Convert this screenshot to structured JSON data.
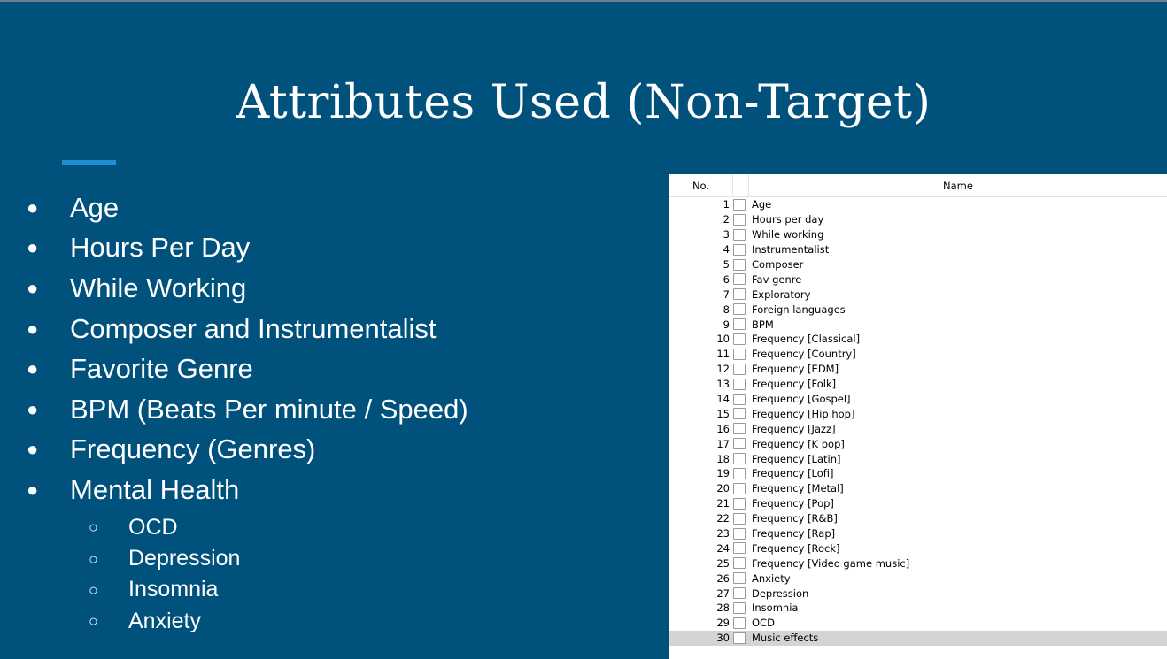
{
  "slide": {
    "title": "Attributes Used (Non-Target)",
    "bullets": [
      "Age",
      "Hours Per Day",
      "While Working",
      "Composer and Instrumentalist",
      "Favorite Genre",
      "BPM (Beats Per minute / Speed)",
      "Frequency (Genres)",
      "Mental Health"
    ],
    "sub_bullets": [
      "OCD",
      "Depression",
      "Insomnia",
      "Anxiety"
    ],
    "bullet_glyph": "●",
    "sub_bullet_glyph": "○",
    "colors": {
      "background": "#00527d",
      "accent_line": "#1e8fd6",
      "text": "#ffffff"
    }
  },
  "attribute_table": {
    "header_no": "No.",
    "header_name": "Name",
    "selected_index": 30,
    "rows": [
      {
        "no": "1",
        "name": "Age"
      },
      {
        "no": "2",
        "name": "Hours per day"
      },
      {
        "no": "3",
        "name": "While working"
      },
      {
        "no": "4",
        "name": "Instrumentalist"
      },
      {
        "no": "5",
        "name": "Composer"
      },
      {
        "no": "6",
        "name": "Fav genre"
      },
      {
        "no": "7",
        "name": "Exploratory"
      },
      {
        "no": "8",
        "name": "Foreign languages"
      },
      {
        "no": "9",
        "name": "BPM"
      },
      {
        "no": "10",
        "name": "Frequency [Classical]"
      },
      {
        "no": "11",
        "name": "Frequency [Country]"
      },
      {
        "no": "12",
        "name": "Frequency [EDM]"
      },
      {
        "no": "13",
        "name": "Frequency [Folk]"
      },
      {
        "no": "14",
        "name": "Frequency [Gospel]"
      },
      {
        "no": "15",
        "name": "Frequency [Hip hop]"
      },
      {
        "no": "16",
        "name": "Frequency [Jazz]"
      },
      {
        "no": "17",
        "name": "Frequency [K pop]"
      },
      {
        "no": "18",
        "name": "Frequency [Latin]"
      },
      {
        "no": "19",
        "name": "Frequency [Lofi]"
      },
      {
        "no": "20",
        "name": "Frequency [Metal]"
      },
      {
        "no": "21",
        "name": "Frequency [Pop]"
      },
      {
        "no": "22",
        "name": "Frequency [R&B]"
      },
      {
        "no": "23",
        "name": "Frequency [Rap]"
      },
      {
        "no": "24",
        "name": "Frequency [Rock]"
      },
      {
        "no": "25",
        "name": "Frequency [Video game music]"
      },
      {
        "no": "26",
        "name": "Anxiety"
      },
      {
        "no": "27",
        "name": "Depression"
      },
      {
        "no": "28",
        "name": "Insomnia"
      },
      {
        "no": "29",
        "name": "OCD"
      },
      {
        "no": "30",
        "name": "Music effects"
      }
    ]
  }
}
